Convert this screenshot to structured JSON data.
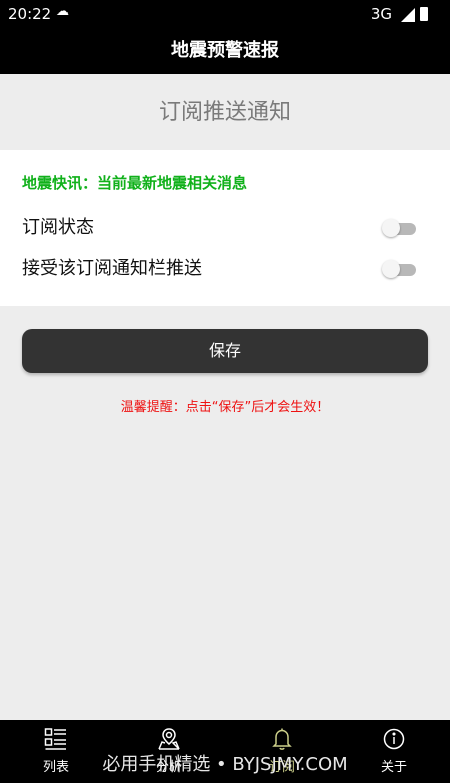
{
  "status_bar": {
    "time": "20:22",
    "network": "3G"
  },
  "app_bar": {
    "title": "地震预警速报"
  },
  "page": {
    "heading": "订阅推送通知"
  },
  "card": {
    "notice": "地震快讯：当前最新地震相关消息",
    "rows": [
      {
        "label": "订阅状态",
        "enabled": false
      },
      {
        "label": "接受该订阅通知栏推送",
        "enabled": false
      }
    ]
  },
  "actions": {
    "save_label": "保存"
  },
  "warning": "温馨提醒：点击“保存”后才会生效！",
  "bottom_nav": {
    "items": [
      {
        "label": "列表",
        "icon": "list-icon"
      },
      {
        "label": "分析",
        "icon": "map-pin-icon"
      },
      {
        "label": "订阅",
        "icon": "bell-icon",
        "active": true
      },
      {
        "label": "关于",
        "icon": "info-icon"
      }
    ]
  },
  "watermark": "必用手机精选 • BYJSJMY.COM",
  "colors": {
    "accent_green": "#11b11b",
    "warning_red": "#ee1111",
    "active_nav": "#ccd08a",
    "button_bg": "#333333"
  }
}
